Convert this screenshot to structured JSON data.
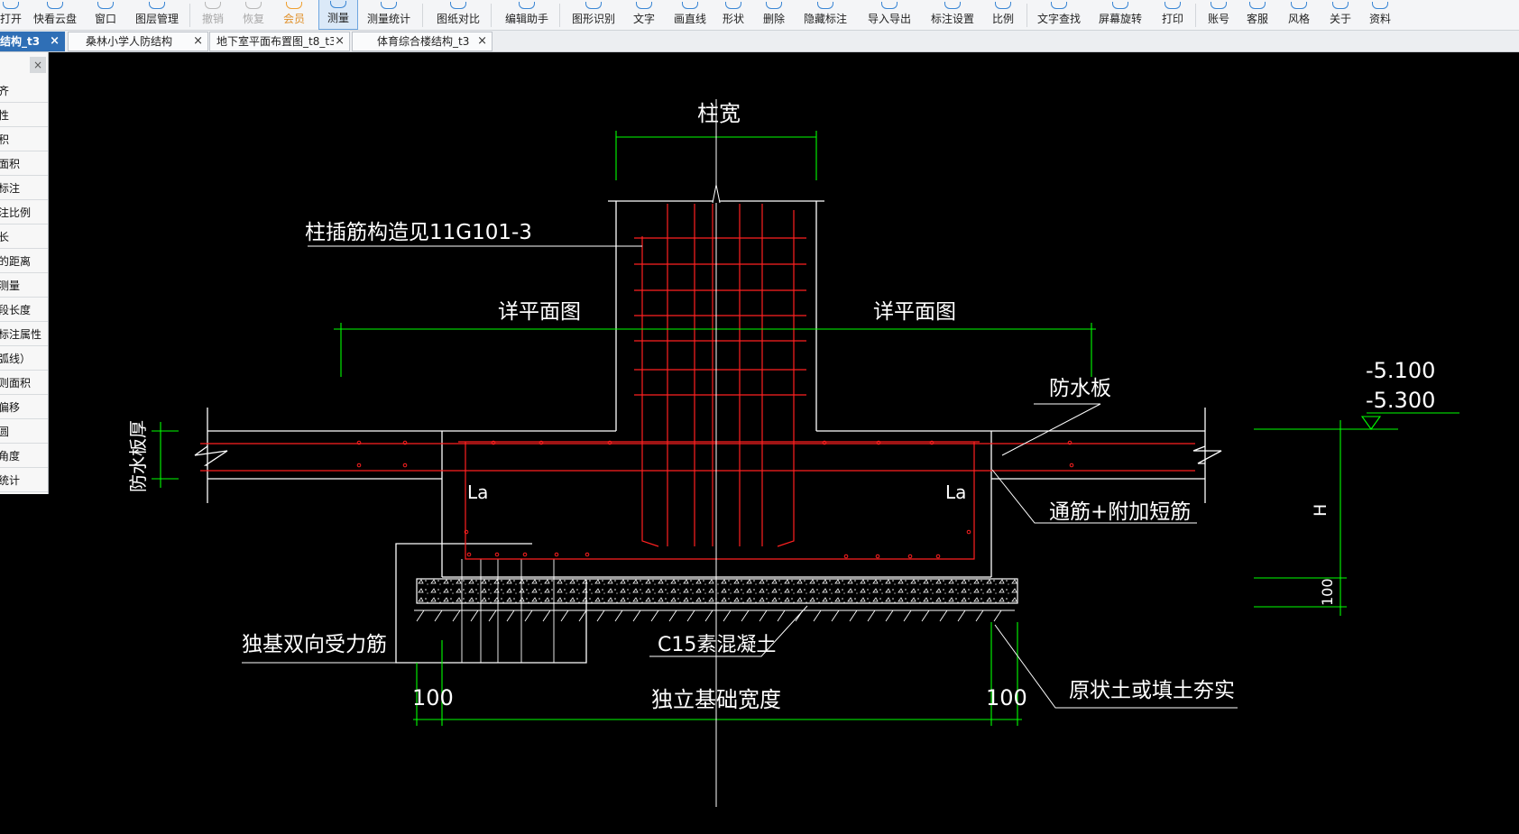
{
  "toolbar": {
    "items": [
      {
        "label": "打开"
      },
      {
        "label": "快看云盘"
      },
      {
        "label": "窗口"
      },
      {
        "label": "图层管理"
      },
      {
        "label": "撤销"
      },
      {
        "label": "恢复"
      },
      {
        "label": "会员"
      },
      {
        "label": "测量"
      },
      {
        "label": "测量统计"
      },
      {
        "label": "图纸对比"
      },
      {
        "label": "编辑助手"
      },
      {
        "label": "图形识别"
      },
      {
        "label": "文字"
      },
      {
        "label": "画直线"
      },
      {
        "label": "形状"
      },
      {
        "label": "删除"
      },
      {
        "label": "隐藏标注"
      },
      {
        "label": "导入导出"
      },
      {
        "label": "标注设置"
      },
      {
        "label": "比例"
      },
      {
        "label": "文字查找"
      },
      {
        "label": "屏幕旋转"
      },
      {
        "label": "打印"
      },
      {
        "label": "账号"
      },
      {
        "label": "客服"
      },
      {
        "label": "风格"
      },
      {
        "label": "关于"
      },
      {
        "label": "资料"
      }
    ]
  },
  "tabs": [
    {
      "label": "结构_t3"
    },
    {
      "label": "桑林小学人防结构"
    },
    {
      "label": "地下室平面布置图_t8_t3"
    },
    {
      "label": "体育综合楼结构_t3"
    }
  ],
  "tab_close_glyph": "×",
  "side_panel": {
    "close_glyph": "×",
    "items": [
      {
        "label": "齐"
      },
      {
        "label": "性"
      },
      {
        "label": "积"
      },
      {
        "label": "面积"
      },
      {
        "label": "标注"
      },
      {
        "label": "注比例"
      },
      {
        "label": "长"
      },
      {
        "label": "的距离"
      },
      {
        "label": "测量"
      },
      {
        "label": "段长度"
      },
      {
        "label": "标注属性"
      },
      {
        "label": "弧线）"
      },
      {
        "label": "则面积"
      },
      {
        "label": "偏移"
      },
      {
        "label": "圆"
      },
      {
        "label": "角度"
      },
      {
        "label": "统计"
      }
    ]
  },
  "drawing": {
    "labels": {
      "column_width": "柱宽",
      "column_dowel_note": "柱插筋构造见11G101-3",
      "see_plan_left": "详平面图",
      "see_plan_right": "详平面图",
      "waterproof_slab": "防水板",
      "waterproof_slab_thickness": "防水板厚",
      "elev_top": "-5.100",
      "elev_bottom": "-5.300",
      "la_left": "La",
      "la_right": "La",
      "through_rebar": "通筋+附加短筋",
      "h_dim": "H",
      "dim_100_right_side": "100",
      "footing_rebar": "独基双向受力筋",
      "c15_concrete": "C15素混凝土",
      "dim_100_left": "100",
      "footing_width": "独立基础宽度",
      "dim_100_right": "100",
      "compacted_soil": "原状土或填土夯实"
    },
    "colors": {
      "background": "#000000",
      "outline": "#ffffff",
      "rebar": "#ff2020",
      "dimension": "#00ff00",
      "ui_accent": "#2f6fb6"
    }
  }
}
